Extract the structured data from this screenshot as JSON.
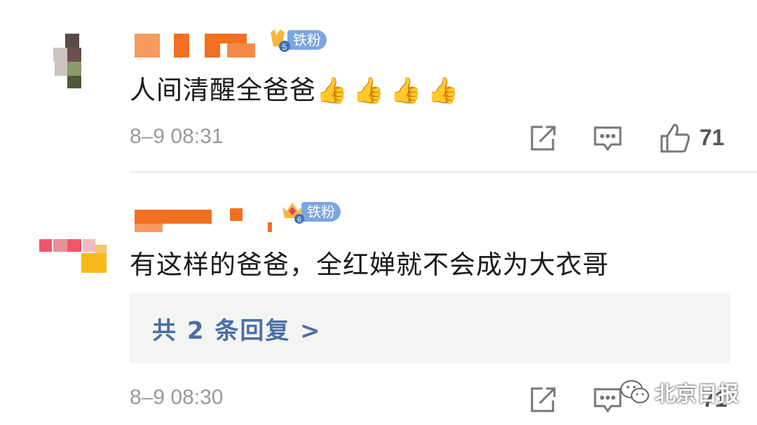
{
  "comments": [
    {
      "text": "人间清醒全爸爸",
      "emoji": "👍👍👍👍",
      "badge_label": "铁粉",
      "badge_level": "5",
      "timestamp": "8–9 08:31",
      "like_count": "71"
    },
    {
      "text": "有这样的爸爸，全红婵就不会成为大衣哥",
      "badge_label": "铁粉",
      "badge_level": "6",
      "reply_summary": "共 2 条回复 >",
      "timestamp": "8–9 08:30",
      "like_count": "71"
    }
  ],
  "watermark": "北京日报",
  "icons": [
    "share-icon",
    "comment-icon",
    "like-icon",
    "wechat-icon"
  ],
  "colors": {
    "name_blur": "#f36f21",
    "badge": "#7ba6e0",
    "reply_link": "#4a6fa5",
    "meta": "#9a9a9a"
  }
}
